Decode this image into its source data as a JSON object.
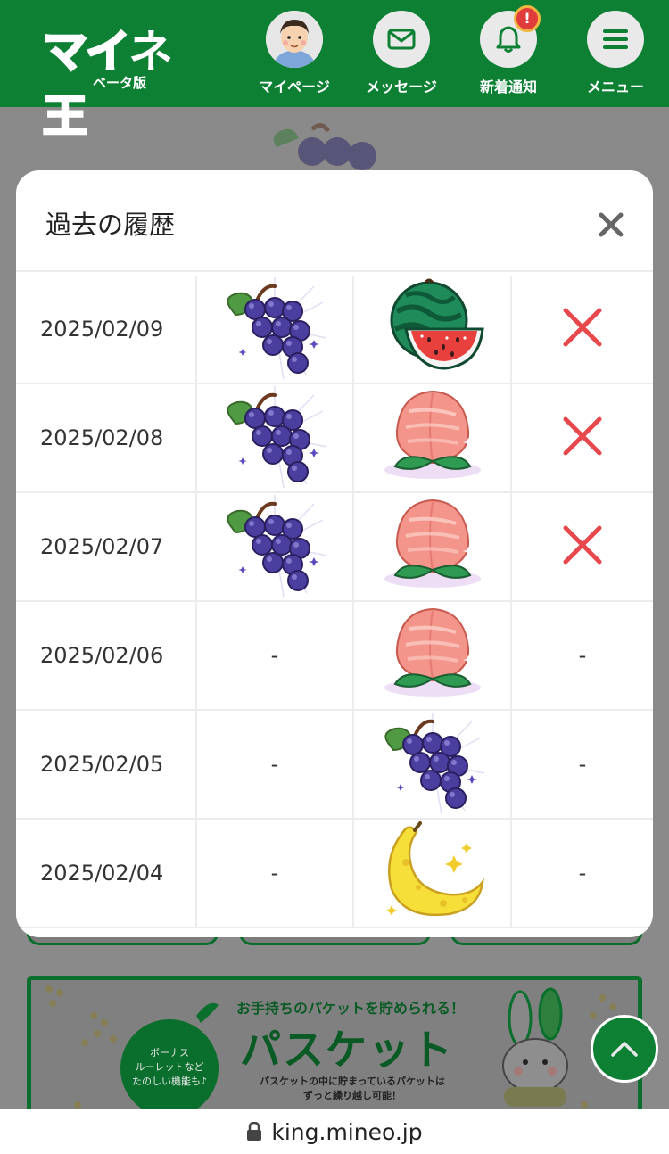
{
  "header": {
    "logo": {
      "part1": "マイ",
      "part2": "ネ",
      "part3": "王",
      "sub": "ベータ版"
    },
    "nav": [
      {
        "label": "マイページ",
        "icon": "avatar"
      },
      {
        "label": "メッセージ",
        "icon": "envelope-icon"
      },
      {
        "label": "新着通知",
        "icon": "bell-icon",
        "badge": "!"
      },
      {
        "label": "メニュー",
        "icon": "hamburger-icon"
      }
    ]
  },
  "modal": {
    "title": "過去の履歴",
    "close_icon": "close-icon",
    "rows": [
      {
        "date": "2025/02/09",
        "col1": "grape",
        "col2": "watermelon",
        "col3": "cross"
      },
      {
        "date": "2025/02/08",
        "col1": "grape",
        "col2": "peach",
        "col3": "cross"
      },
      {
        "date": "2025/02/07",
        "col1": "grape",
        "col2": "peach",
        "col3": "cross"
      },
      {
        "date": "2025/02/06",
        "col1": "-",
        "col2": "peach",
        "col3": "-"
      },
      {
        "date": "2025/02/05",
        "col1": "-",
        "col2": "grape",
        "col3": "-"
      },
      {
        "date": "2025/02/04",
        "col1": "-",
        "col2": "banana",
        "col3": "-"
      }
    ]
  },
  "banner": {
    "circle_text": "ボーナス\nルーレットなど\nたのしい機能も♪",
    "subtitle": "お手持ちのパケットを貯められる！",
    "title": "パスケット",
    "description": "パスケットの中に貯まっているパケットは\nずっと繰り越し可能！"
  },
  "urlbar": {
    "url": "king.mineo.jp"
  },
  "colors": {
    "header_green": "#0d8034",
    "cross_red": "#e8484c",
    "grape": "#4a3e9e",
    "peach": "#f3958a"
  }
}
